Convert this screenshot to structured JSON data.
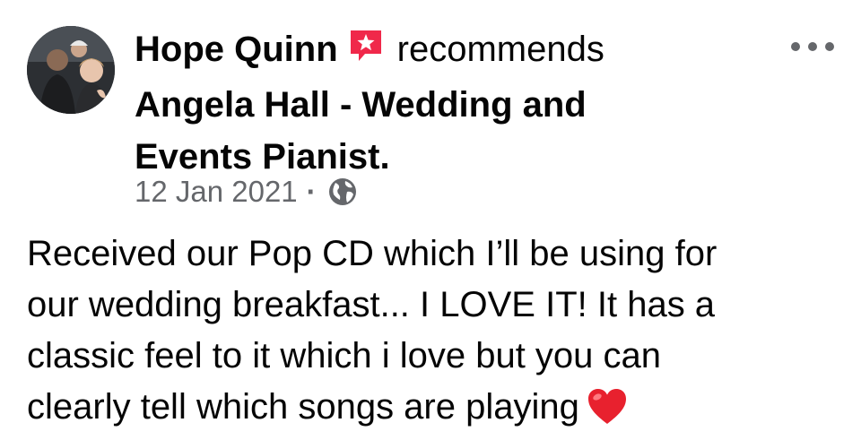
{
  "post": {
    "author": "Hope Quinn",
    "verb": "recommends",
    "page_name_line1": "Angela Hall - Wedding and",
    "page_name_line2": "Events Pianist.",
    "date": "12 Jan 2021",
    "separator": "·",
    "body_lines": [
      "Received our Pop CD which I’ll be using for",
      "our wedding breakfast... I LOVE IT! It has a",
      "classic feel to it which i love but you can",
      "clearly tell which songs are playing"
    ],
    "icons": {
      "recommend": "recommend-star-icon",
      "audience": "globe-icon",
      "more": "more-options-icon",
      "emoji": "red-heart-icon"
    },
    "colors": {
      "recommend_badge": "#f0284a",
      "meta_text": "#65676b",
      "heart": "#e8212e"
    }
  }
}
